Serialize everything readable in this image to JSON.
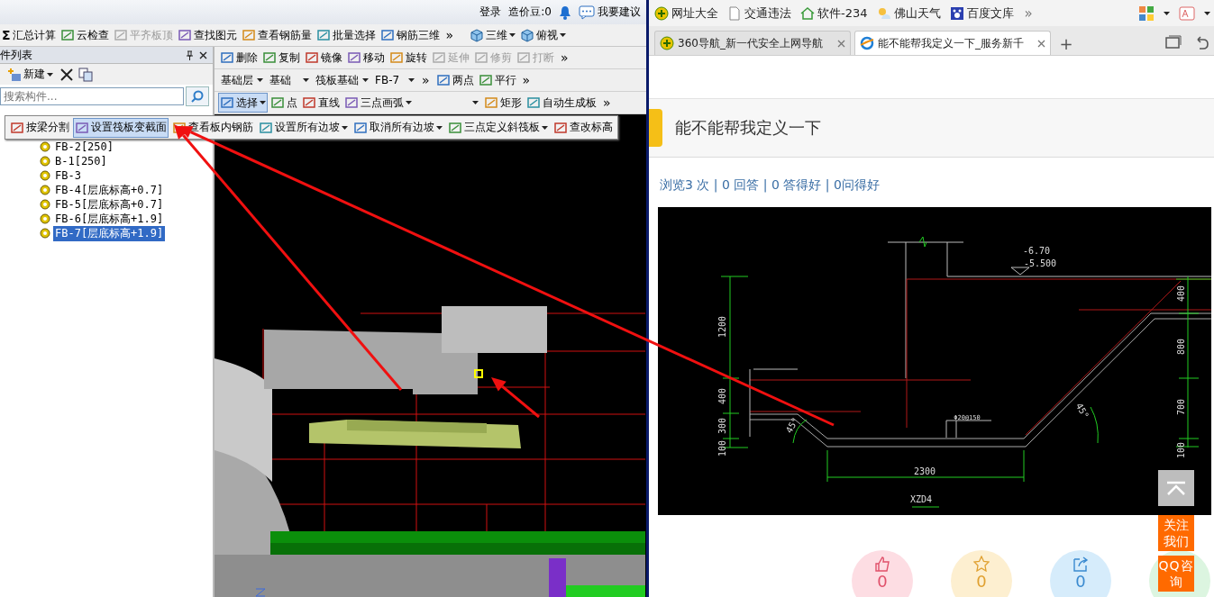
{
  "app": {
    "top_bar": {
      "links": [
        "登录",
        "造价豆:0"
      ],
      "suggest": "我要建议"
    },
    "main_toolbar": {
      "items": [
        {
          "label": "汇总计算",
          "glyph": "Σ",
          "disabled": false
        },
        {
          "label": "云检查",
          "disabled": false
        },
        {
          "label": "平齐板顶",
          "disabled": true
        },
        {
          "label": "查找图元",
          "disabled": false
        },
        {
          "label": "查看钢筋量",
          "disabled": false
        },
        {
          "label": "批量选择",
          "disabled": false
        },
        {
          "label": "钢筋三维",
          "disabled": false
        }
      ],
      "overflow": "»"
    },
    "view_controls": [
      {
        "label": "三维"
      },
      {
        "label": "俯视"
      }
    ],
    "component_list": {
      "title": "件列表",
      "new_button": "新建",
      "search_placeholder": "搜索构件...",
      "items": [
        {
          "label": "FB-2[250]",
          "selected": false
        },
        {
          "label": "B-1[250]",
          "selected": false
        },
        {
          "label": "FB-3",
          "selected": false
        },
        {
          "label": "FB-4[层底标高+0.7]",
          "selected": false
        },
        {
          "label": "FB-5[层底标高+0.7]",
          "selected": false
        },
        {
          "label": "FB-6[层底标高+1.9]",
          "selected": false
        },
        {
          "label": "FB-7[层底标高+1.9]",
          "selected": true
        }
      ]
    },
    "edit_toolbar": {
      "items": [
        {
          "label": "删除",
          "disabled": false
        },
        {
          "label": "复制",
          "disabled": false
        },
        {
          "label": "镜像",
          "disabled": false
        },
        {
          "label": "移动",
          "disabled": false
        },
        {
          "label": "旋转",
          "disabled": false
        },
        {
          "label": "延伸",
          "disabled": true
        },
        {
          "label": "修剪",
          "disabled": true
        },
        {
          "label": "打断",
          "disabled": true
        }
      ],
      "overflow": "»"
    },
    "layer_selectors": {
      "items": [
        "基础层",
        "基础",
        "筏板基础",
        "FB-7"
      ],
      "overflow": "»"
    },
    "snap_toolbar": {
      "items": [
        {
          "label": "两点"
        },
        {
          "label": "平行"
        }
      ],
      "overflow": "»"
    },
    "draw_toolbar": {
      "items": [
        {
          "label": "选择",
          "selected": true,
          "dropdown": true
        },
        {
          "label": "点",
          "selected": false,
          "dropdown": false
        },
        {
          "label": "直线",
          "selected": false,
          "dropdown": false
        },
        {
          "label": "三点画弧",
          "selected": false,
          "dropdown": true
        },
        {
          "label": "矩形",
          "selected": false,
          "dropdown": false
        },
        {
          "label": "自动生成板",
          "selected": false,
          "dropdown": false
        }
      ],
      "overflow": "»"
    },
    "floating_toolbar": {
      "items": [
        {
          "label": "按梁分割",
          "selected": false,
          "dropdown": false
        },
        {
          "label": "设置筏板变截面",
          "selected": true,
          "dropdown": false
        },
        {
          "label": "查看板内钢筋",
          "selected": false,
          "dropdown": false
        },
        {
          "label": "设置所有边坡",
          "selected": false,
          "dropdown": true
        },
        {
          "label": "取消所有边坡",
          "selected": false,
          "dropdown": true
        },
        {
          "label": "三点定义斜筏板",
          "selected": false,
          "dropdown": true
        },
        {
          "label": "查改标高",
          "selected": false,
          "dropdown": false
        }
      ]
    }
  },
  "browser": {
    "bookmarks": {
      "items": [
        "网址大全",
        "交通违法",
        "软件-234",
        "佛山天气",
        "百度文库"
      ],
      "overflow": "»"
    },
    "tabs": [
      {
        "title": "360导航_新一代安全上网导航",
        "selected": false
      },
      {
        "title": "能不能帮我定义一下_服务新千",
        "selected": true
      }
    ],
    "new_tab": "+",
    "question": {
      "title": "能不能帮我定义一下",
      "stats": "浏览3 次 | 0 回答 | 0 答得好 | 0问得好"
    },
    "figure": {
      "labels": [
        "-6.70",
        "-5.500",
        "1200",
        "400",
        "300",
        "100",
        "400",
        "800",
        "700",
        "100",
        "2300",
        "45°",
        "45°",
        "Φ20@150",
        "XZD4"
      ]
    },
    "side_buttons": [
      "关注我们",
      "QQ咨询"
    ],
    "actions": [
      {
        "count": "0",
        "color": "#fddde3"
      },
      {
        "count": "0",
        "color": "#fdefd0"
      },
      {
        "count": "0",
        "color": "#d6ecfb"
      },
      {
        "color": "#dcf5e0"
      }
    ]
  }
}
